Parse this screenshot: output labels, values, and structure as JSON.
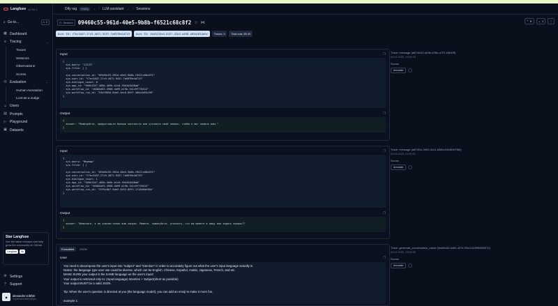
{
  "app": {
    "name": "Langfuse",
    "version": "v2.94.1"
  },
  "sidebar": {
    "goto_label": "Go to...",
    "goto_shortcut": "⌘ K",
    "items": [
      {
        "label": "Dashboard",
        "icon": "dashboard-icon"
      },
      {
        "label": "Tracing",
        "icon": "tracing-icon"
      },
      {
        "label": "Evaluation",
        "icon": "evaluation-icon"
      },
      {
        "label": "Users",
        "icon": "users-icon"
      },
      {
        "label": "Prompts",
        "icon": "prompts-icon"
      },
      {
        "label": "Playground",
        "icon": "playground-icon"
      },
      {
        "label": "Datasets",
        "icon": "datasets-icon"
      }
    ],
    "tracing_sub": [
      "Traces",
      "Sessions",
      "Observations",
      "Scores"
    ],
    "evaluation_sub": [
      "Human Annotation",
      "LLM-as-a-Judge"
    ],
    "star_card": {
      "title": "Star Langfuse",
      "description": "See the latest releases and help grow the community on GitHub",
      "btn1": "Langfuse",
      "btn2": "6k"
    },
    "settings_label": "Settings",
    "support_label": "Support",
    "user": {
      "name": "alexander.volkhin",
      "email": "coyeerasovalex@gm..."
    }
  },
  "header": {
    "project": "Dify rag",
    "plan": "Hobby",
    "org": "LLM assistant",
    "page": "Sessions"
  },
  "session": {
    "tag": "Session",
    "id": "09460c55-961d-40e5-9b8b-f6521c68c8f2",
    "chips": [
      {
        "text": "User ID: f7ec3407-27c9-4071-9457-7e0939e4d719",
        "style": "light"
      },
      {
        "text": "User ID: 6443215e4-8327-42b3-a038-e85b2834a9e",
        "style": "light"
      },
      {
        "text": "Traces: 3",
        "style": "dark"
      },
      {
        "text": "Total cost: $0.00",
        "style": "dark"
      }
    ],
    "nav_count1": "K",
    "nav_count2": "J"
  },
  "traces": [
    {
      "input_label": "Input",
      "output_label": "Output",
      "input_lines": [
        "{",
        "  sys.query: \"12122\"",
        "  sys.files: [ ]",
        "",
        "  sys.conversation_id: \"09460c55-961d-40e5-9b8b-f6521c68c8f2\"",
        "  sys.user_id: \"f7ec3407-27c9-4071-9457-7e0939e4d719\"",
        "  sys.dialogue_count: 0",
        "  sys.app_id: \"9d9e1347-485b-4b9b-b1c0-f8d1b2b58ab\"",
        "  sys.workflow_id: \"e68b5e63-4968-4b99-b19b-fa1c9f7f6412\"",
        "  sys.workflow_run_id: \"53df883d-8da5-4ec6-80ff-48da3d53c98\"",
        "}"
      ],
      "output_lines": [
        "{",
        "  answer: \"Пожалуйста, предоставьте больше контекста или уточните свой запрос, чтобы я мог помочь вам.\"",
        "}"
      ],
      "meta_title": "Trace: message (a874f412-de9b-426e-a797-b5b4f9)",
      "meta_date": "04.03.2025, 23:59:15",
      "scores_label": "Scores",
      "annotate_label": "Annotate"
    },
    {
      "input_label": "Input",
      "output_label": "Output",
      "input_lines": [
        "{",
        "  sys.query: \"Фырвыр\"",
        "  sys.files: [ ]",
        "",
        "  sys.conversation_id: \"09460c55-961d-40e5-9b8b-f6521c68c8f2\"",
        "  sys.user_id: \"f7ec3407-27c9-4071-9457-7e0939e4d719\"",
        "  sys.dialogue_count: 1",
        "  sys.app_id: \"9d9e1347-485b-4b9b-b1c0-f8d1b2b58ab\"",
        "  sys.workflow_id: \"e68b5e63-4968-4b99-b19b-fa1c9f7f6412\"",
        "  sys.workflow_run_id: \"15f0c8b7-6de3-4553-89f1-1f18a9de38e\"",
        "}"
      ],
      "output_lines": [
        "{",
        "  answer: \"Извините, я не совсем понял ваш запрос. Можете, пожалуйста, уточнить, что вы имеете в виду или задать вопрос?\"",
        "}"
      ],
      "meta_title": "Trace: message (a874f1c-0b02-4c41-838d-e0b4f24f7f66)",
      "meta_date": "04.03.2025, 23:59:31",
      "scores_label": "Scores",
      "annotate_label": "Annotate"
    }
  ],
  "generation": {
    "tabs": [
      "Formatted",
      "JSON"
    ],
    "role": "User",
    "lines": [
      "You need to decompose the user's input into \"subject\" and \"intention\" in order to accurately figure out what the user's input language actually is.",
      "Notice: the language type user use could be diverse, which can be English, Chinese, Español, Arabic, Japanese, French, and etc.",
      "MAKE SURE your output is the SAME language as the user's input!",
      "Your output is restricted only to: (Input language) Intention + Subject(short as possible)",
      "Your output MUST be a valid JSON.",
      "",
      "Tip: When the user's question is directed at you (the language model), you can add an emoji to make it more fun.",
      "",
      "example 1:"
    ],
    "meta_title": "Trace: generate_conversation_name (bedfec62-0d62-427e-93e4-026f9b65407c)",
    "meta_date": "04.03.2025, 23:59:30",
    "scores_label": "Scores",
    "annotate_label": "Annotate"
  }
}
